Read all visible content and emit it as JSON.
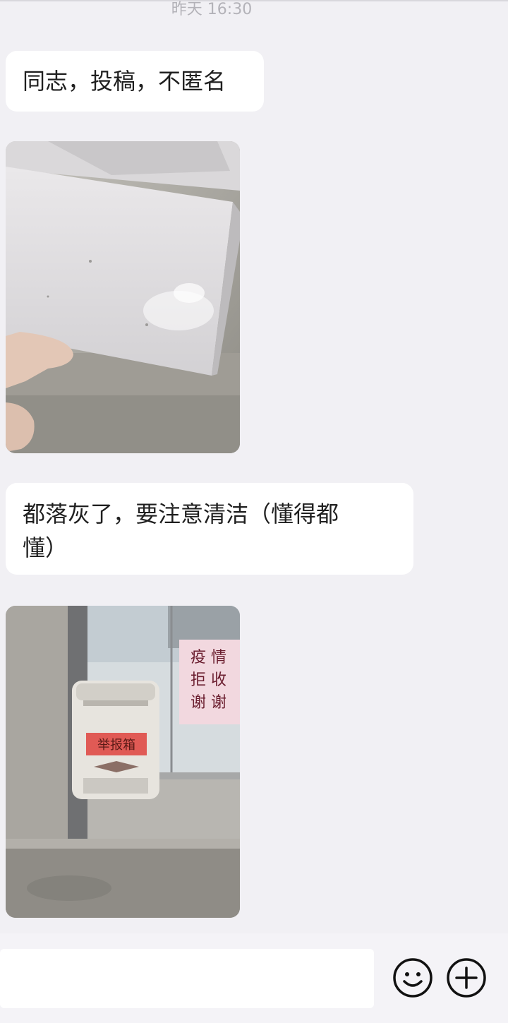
{
  "chat": {
    "timestamp": "昨天 16:30",
    "messages": [
      {
        "type": "text",
        "text": "同志，投稿，不匿名"
      },
      {
        "type": "image",
        "subject": "dusty box cover held in hand"
      },
      {
        "type": "text",
        "text": "都落灰了，要注意清洁（懂得都\n懂）"
      },
      {
        "type": "image",
        "subject": "wall-mounted report box beside glass door"
      }
    ]
  },
  "photo2_text": {
    "box_label": "举报箱",
    "sign_lines": [
      "疫 情",
      "拒 收",
      "谢 谢"
    ]
  },
  "input_bar": {
    "placeholder": "",
    "value": ""
  },
  "icons": {
    "emoji": "smiley-face-icon",
    "plus": "plus-circle-icon"
  },
  "colors": {
    "background": "#f1f0f4",
    "bubble": "#ffffff",
    "text": "#1f1f1f",
    "timestamp": "#b3b2b8",
    "box_label_bg": "#e05a55",
    "sign_bg": "#f2d8df"
  }
}
